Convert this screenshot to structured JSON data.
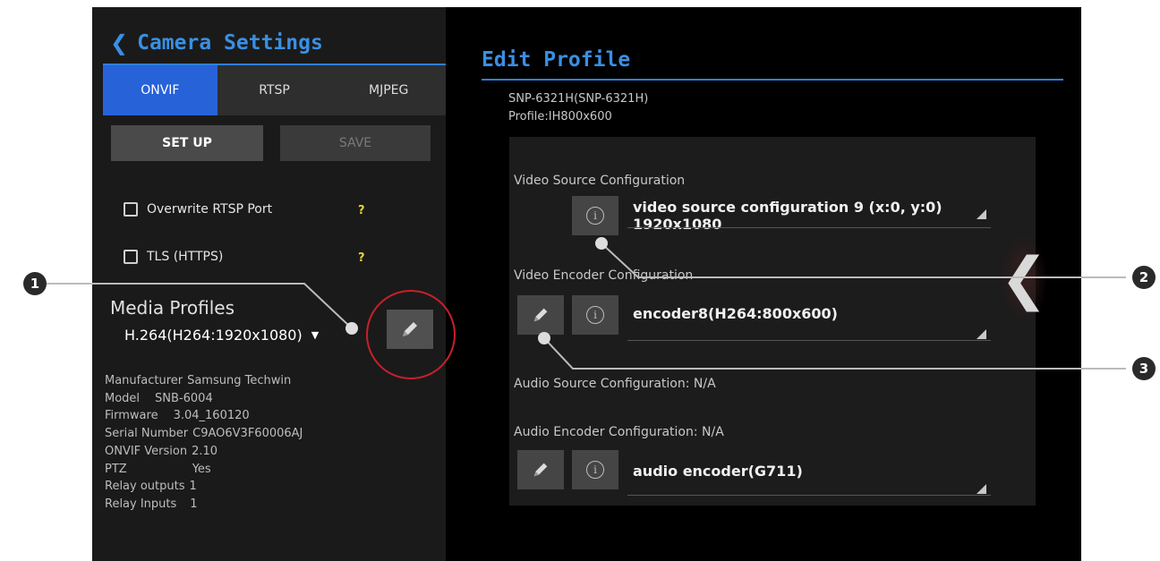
{
  "camera_settings": {
    "title": "Camera Settings",
    "back_icon": "chevron-left-icon",
    "tabs": [
      {
        "label": "ONVIF",
        "active": true
      },
      {
        "label": "RTSP",
        "active": false
      },
      {
        "label": "MJPEG",
        "active": false
      }
    ],
    "setup_label": "SET UP",
    "save_label": "SAVE",
    "options": [
      {
        "label": "Overwrite RTSP Port",
        "checked": false,
        "help": "?"
      },
      {
        "label": "TLS (HTTPS)",
        "checked": false,
        "help": "?"
      }
    ],
    "media_profiles_label": "Media Profiles",
    "media_profile_value": "H.264(H264:1920x1080)",
    "edit_icon": "pencil-icon",
    "device_info": [
      {
        "key": "Manufacturer",
        "value": "Samsung Techwin"
      },
      {
        "key": "Model",
        "value": "SNB-6004"
      },
      {
        "key": "Firmware",
        "value": "3.04_160120"
      },
      {
        "key": "Serial Number",
        "value": "C9AO6V3F60006AJ"
      },
      {
        "key": "ONVIF Version",
        "value": "2.10"
      },
      {
        "key": "PTZ",
        "value": "Yes"
      },
      {
        "key": "Relay outputs",
        "value": "1"
      },
      {
        "key": "Relay Inputs",
        "value": "1"
      }
    ]
  },
  "edit_profile": {
    "title": "Edit Profile",
    "device": "SNP-6321H(SNP-6321H)",
    "profile": "Profile:IH800x600",
    "video_source_label": "Video Source Configuration",
    "video_source_value": "video source configuration 9 (x:0, y:0) 1920x1080",
    "video_encoder_label": "Video Encoder Configuration",
    "video_encoder_value": "encoder8(H264:800x600)",
    "audio_source_label": "Audio Source Configuration: N/A",
    "audio_encoder_label": "Audio Encoder Configuration: N/A",
    "audio_encoder_value": "audio encoder(G711)",
    "info_glyph": "i",
    "side_arrow": "❮"
  },
  "callouts": [
    "1",
    "2",
    "3"
  ],
  "colors": {
    "accent": "#2f7fd8",
    "tab_active": "#2762d9",
    "help": "#e8d437",
    "highlight_ring": "#c8202a"
  }
}
